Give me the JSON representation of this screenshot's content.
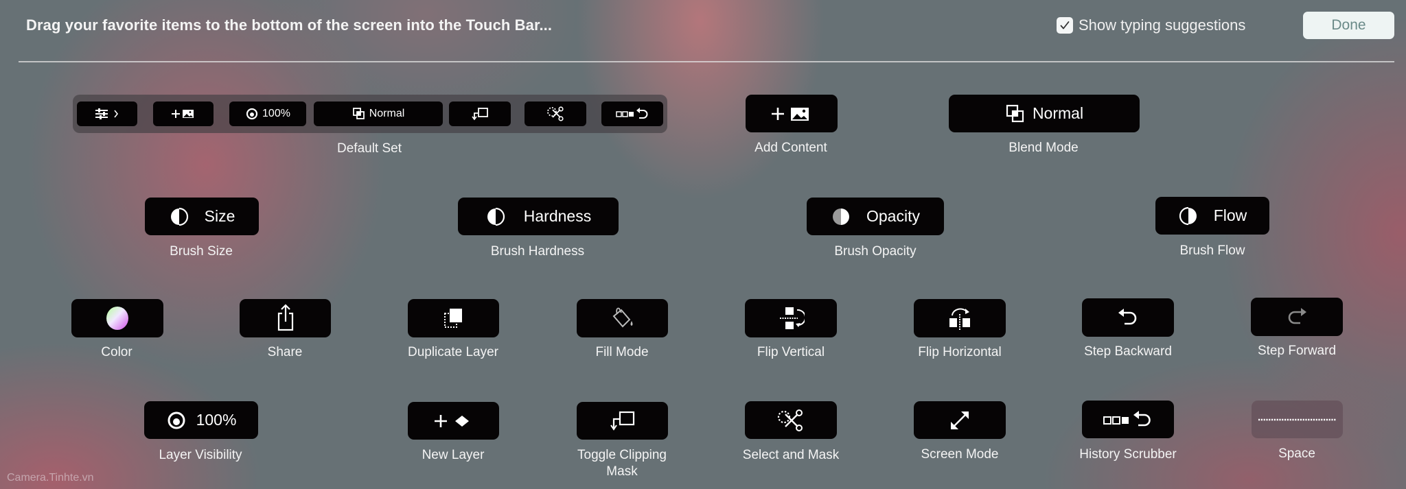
{
  "header": {
    "title": "Drag your favorite items to the bottom of the screen into the Touch Bar...",
    "show_suggestions_label": "Show typing suggestions",
    "show_suggestions_checked": true,
    "done_label": "Done"
  },
  "default_set": {
    "label": "Default Set",
    "buttons": [
      {
        "icon": "sliders-chevron-icon",
        "text": ""
      },
      {
        "icon": "add-image-icon",
        "text": ""
      },
      {
        "icon": "eye-icon",
        "text": "100%"
      },
      {
        "icon": "blend-mode-icon",
        "text": "Normal"
      },
      {
        "icon": "clipping-mask-icon",
        "text": ""
      },
      {
        "icon": "select-mask-icon",
        "text": ""
      },
      {
        "icon": "history-scrubber-icon",
        "text": ""
      }
    ]
  },
  "items": {
    "add_content": {
      "label": "Add Content",
      "icon": "add-image-icon"
    },
    "blend_mode": {
      "label": "Blend Mode",
      "icon": "blend-mode-icon",
      "value": "Normal"
    },
    "brush_size": {
      "label": "Brush Size",
      "icon": "half-circle-icon",
      "value": "Size"
    },
    "brush_hardness": {
      "label": "Brush Hardness",
      "icon": "half-circle-icon",
      "value": "Hardness"
    },
    "brush_opacity": {
      "label": "Brush Opacity",
      "icon": "half-circle-icon",
      "value": "Opacity"
    },
    "brush_flow": {
      "label": "Brush Flow",
      "icon": "half-circle-icon",
      "value": "Flow"
    },
    "color": {
      "label": "Color",
      "icon": "color-wheel-icon"
    },
    "share": {
      "label": "Share",
      "icon": "share-icon"
    },
    "duplicate_layer": {
      "label": "Duplicate Layer",
      "icon": "duplicate-layer-icon"
    },
    "fill_mode": {
      "label": "Fill Mode",
      "icon": "paint-bucket-icon"
    },
    "flip_vertical": {
      "label": "Flip Vertical",
      "icon": "flip-vertical-icon"
    },
    "flip_horizontal": {
      "label": "Flip Horizontal",
      "icon": "flip-horizontal-icon"
    },
    "step_backward": {
      "label": "Step Backward",
      "icon": "undo-icon"
    },
    "step_forward": {
      "label": "Step Forward",
      "icon": "redo-icon"
    },
    "layer_visibility": {
      "label": "Layer Visibility",
      "icon": "eye-icon",
      "value": "100%"
    },
    "new_layer": {
      "label": "New Layer",
      "icon": "new-layer-icon"
    },
    "toggle_clipping_mask": {
      "label": "Toggle Clipping Mask",
      "icon": "clipping-mask-icon"
    },
    "select_and_mask": {
      "label": "Select and Mask",
      "icon": "select-mask-icon"
    },
    "screen_mode": {
      "label": "Screen Mode",
      "icon": "expand-arrows-icon"
    },
    "history_scrubber": {
      "label": "History Scrubber",
      "icon": "history-scrubber-icon"
    },
    "space": {
      "label": "Space",
      "icon": "dotted-spacer-icon"
    }
  },
  "watermark": "Camera.Tinhte.vn"
}
